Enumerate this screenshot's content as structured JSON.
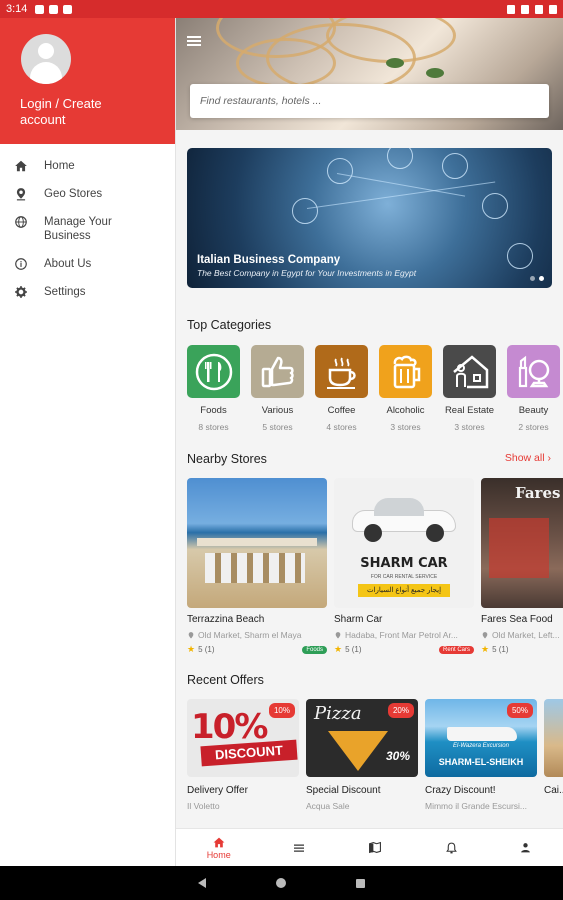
{
  "status_bar": {
    "time": "3:14"
  },
  "drawer": {
    "login_label": "Login / Create account",
    "items": [
      {
        "label": "Home",
        "icon": "home-icon"
      },
      {
        "label": "Geo Stores",
        "icon": "location-pin-icon"
      },
      {
        "label": "Manage Your Business",
        "icon": "globe-icon"
      },
      {
        "label": "About Us",
        "icon": "info-icon"
      },
      {
        "label": "Settings",
        "icon": "gear-icon"
      }
    ]
  },
  "search": {
    "placeholder": "Find restaurants, hotels ..."
  },
  "banner": {
    "title": "Italian Business Company",
    "subtitle": "The Best Company in Egypt for Your Investments in Egypt"
  },
  "sections": {
    "categories_title": "Top Categories",
    "nearby_title": "Nearby Stores",
    "show_all": "Show all",
    "offers_title": "Recent Offers"
  },
  "categories": [
    {
      "name": "Foods",
      "count": "8 stores",
      "color": "#3aa35a"
    },
    {
      "name": "Various",
      "count": "5 stores",
      "color": "#b5ab93"
    },
    {
      "name": "Coffee",
      "count": "4 stores",
      "color": "#b06a1a"
    },
    {
      "name": "Alcoholic",
      "count": "3 stores",
      "color": "#f0a21c"
    },
    {
      "name": "Real Estate",
      "count": "3 stores",
      "color": "#4a4a4a"
    },
    {
      "name": "Beauty",
      "count": "2 stores",
      "color": "#c58ad1"
    }
  ],
  "stores": [
    {
      "name": "Terrazzina Beach",
      "address": "Old Market, Sharm el Maya",
      "rating": "5 (1)",
      "tag": "Foods",
      "tag_color": "#2e9e57"
    },
    {
      "name": "Sharm Car",
      "address": "Hadaba, Front Mar Petrol Ar...",
      "rating": "5 (1)",
      "tag": "Rent Cars",
      "tag_color": "#e63a35",
      "img_title": "SHARM CAR",
      "img_sub": "FOR CAR RENTAL SERVICE",
      "img_banner": "إيجار جميع أنواع السيارات"
    },
    {
      "name": "Fares Sea Food",
      "address": "Old Market, Left...",
      "rating": "5 (1)",
      "img_sign": "Fares"
    }
  ],
  "offers": [
    {
      "name": "Delivery Offer",
      "store": "Il Voletto",
      "badge": "10%",
      "img_text1": "10%",
      "img_text2": "DISCOUNT"
    },
    {
      "name": "Special Discount",
      "store": "Acqua Sale",
      "badge": "20%",
      "img_text1": "Pizza",
      "img_text2": "30%"
    },
    {
      "name": "Crazy Discount!",
      "store": "Mimmo il Grande Escursi...",
      "badge": "50%",
      "img_text1": "El-Wazera Excursion",
      "img_text2": "SHARM-EL-SHEIKH"
    },
    {
      "name": "Cai...",
      "store": "",
      "badge": ""
    }
  ],
  "bottom_nav": {
    "home_label": "Home",
    "items": [
      "home-icon",
      "list-icon",
      "map-icon",
      "bell-icon",
      "person-icon"
    ]
  },
  "colors": {
    "accent": "#e63a35"
  }
}
